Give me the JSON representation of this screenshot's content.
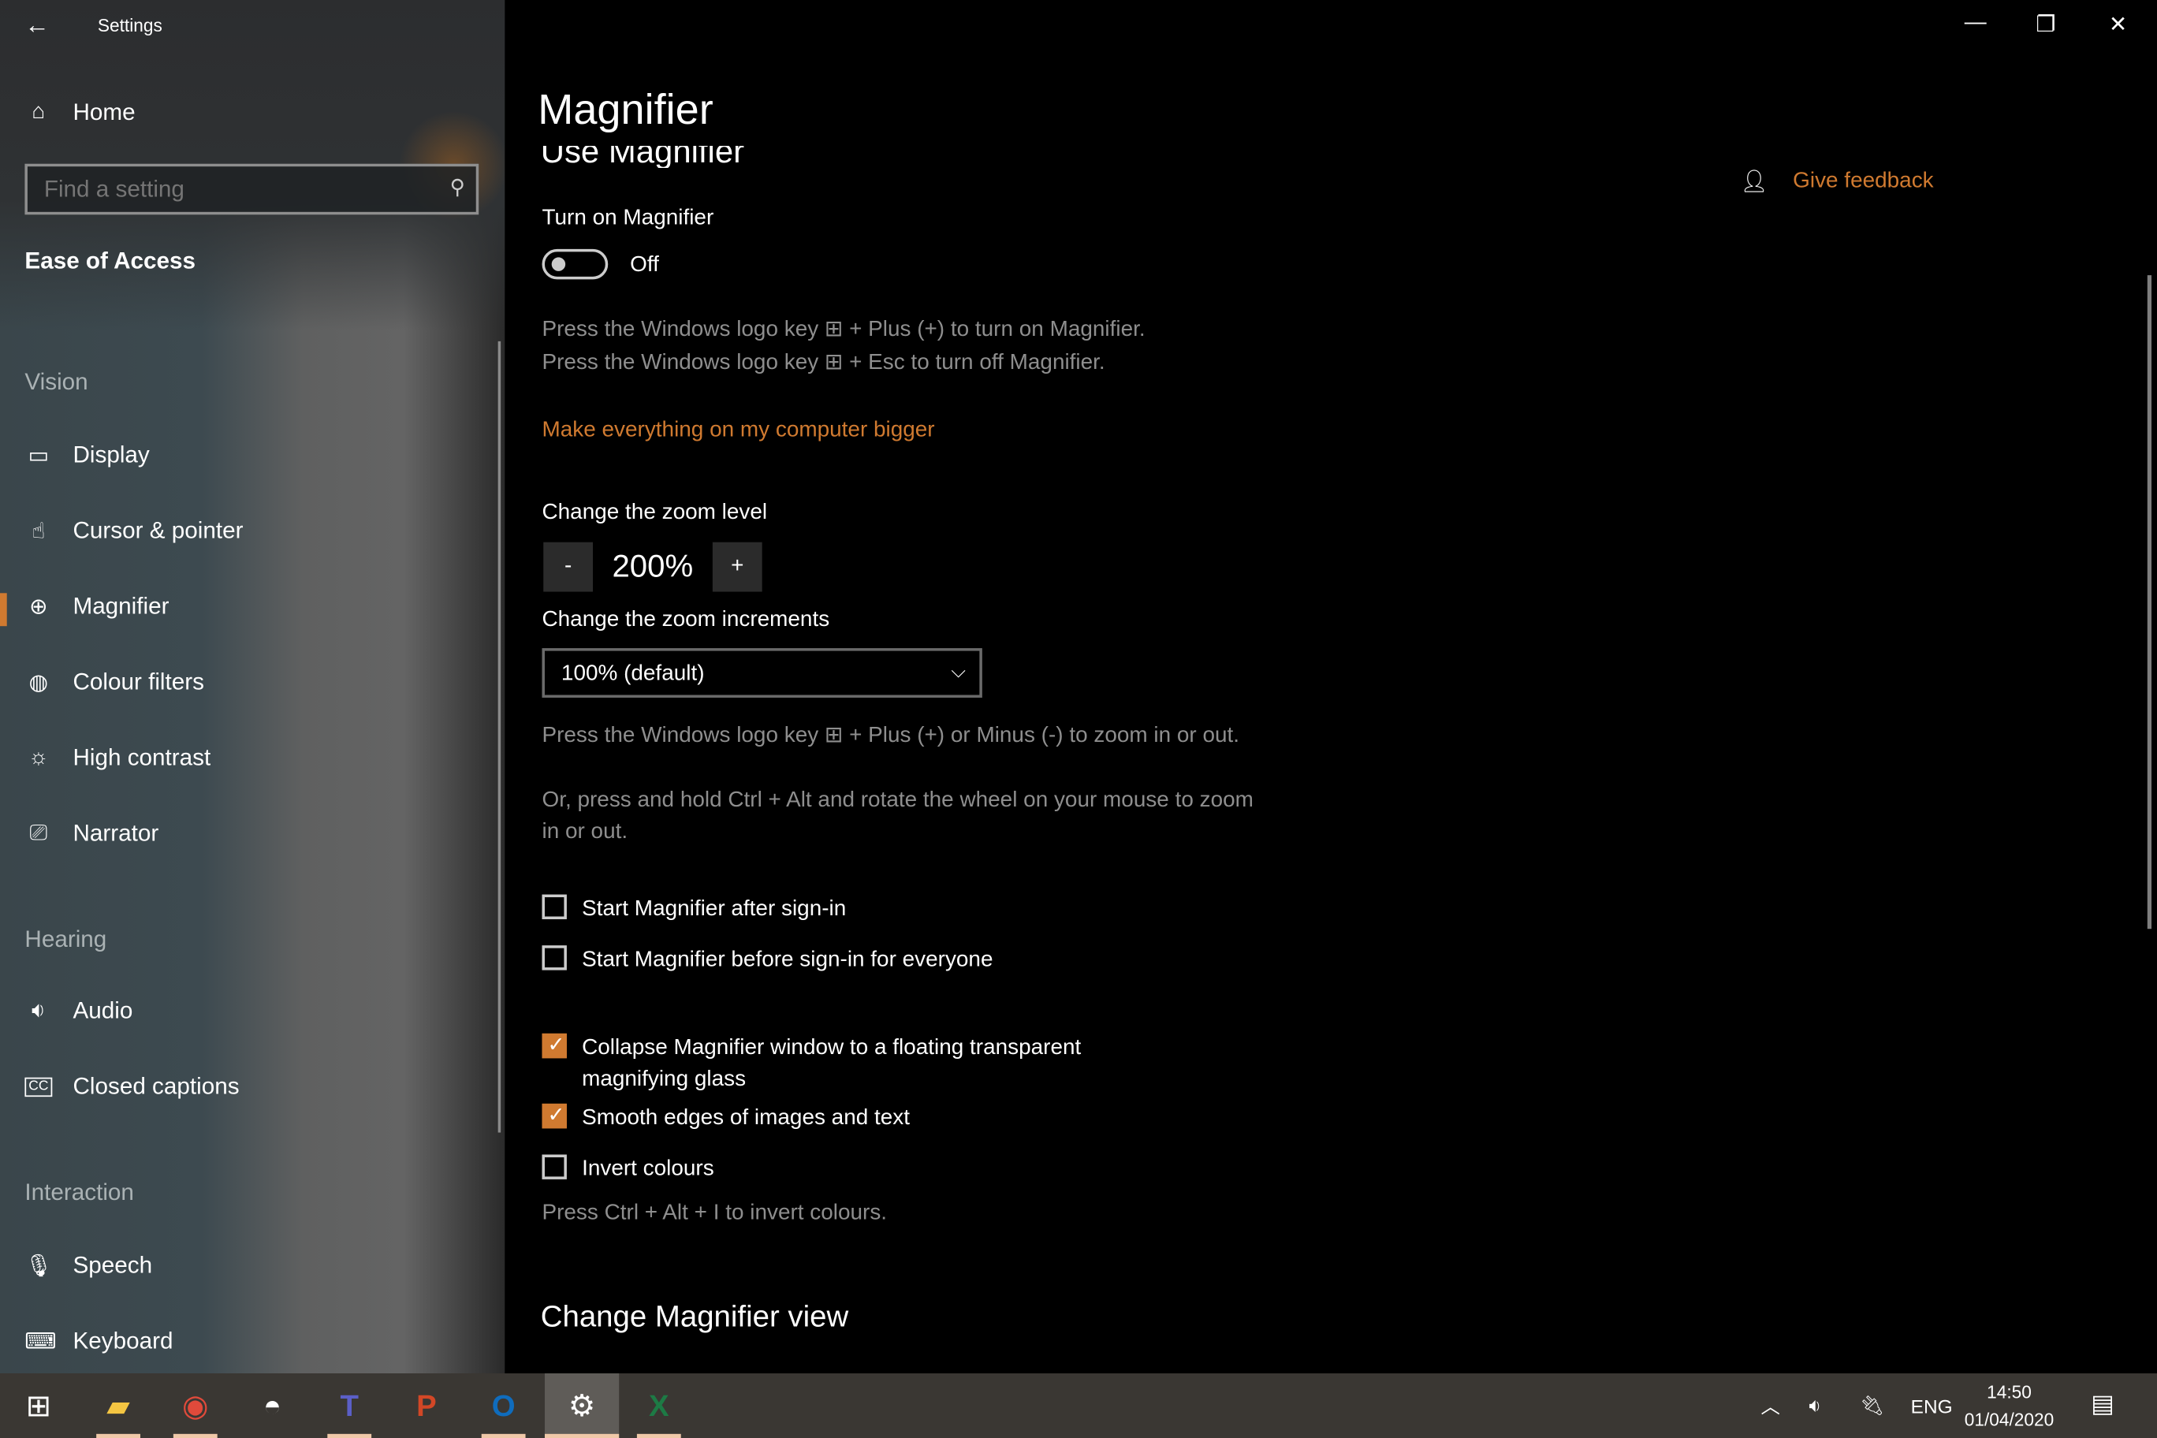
{
  "window": {
    "app_title": "Settings",
    "controls": {
      "minimize": "—",
      "restore": "❐",
      "close": "✕"
    }
  },
  "sidebar": {
    "home": "Home",
    "search_placeholder": "Find a setting",
    "category": "Ease of Access",
    "groups": {
      "vision": "Vision",
      "hearing": "Hearing",
      "interaction": "Interaction"
    },
    "items": [
      {
        "label": "Display",
        "icon": "display-icon"
      },
      {
        "label": "Cursor & pointer",
        "icon": "cursor-pointer-icon"
      },
      {
        "label": "Magnifier",
        "icon": "magnifier-icon",
        "active": true
      },
      {
        "label": "Colour filters",
        "icon": "palette-icon"
      },
      {
        "label": "High contrast",
        "icon": "brightness-icon"
      },
      {
        "label": "Narrator",
        "icon": "narrator-icon"
      },
      {
        "label": "Audio",
        "icon": "speaker-icon"
      },
      {
        "label": "Closed captions",
        "icon": "cc-icon"
      },
      {
        "label": "Speech",
        "icon": "microphone-icon"
      },
      {
        "label": "Keyboard",
        "icon": "keyboard-icon"
      }
    ]
  },
  "main": {
    "page_title": "Magnifier",
    "section_title": "Use Magnifier",
    "turn_on_label": "Turn on Magnifier",
    "toggle_state": "Off",
    "hint_on": "Press the Windows logo key ⊞ + Plus (+) to turn on Magnifier.",
    "hint_off": "Press the Windows logo key ⊞ + Esc to turn off Magnifier.",
    "bigger_link": "Make everything on my computer bigger",
    "zoom_level_label": "Change the zoom level",
    "zoom_minus": "-",
    "zoom_value": "200%",
    "zoom_plus": "+",
    "zoom_increments_label": "Change the zoom increments",
    "zoom_increments_value": "100% (default)",
    "zoom_hint_1": "Press the Windows logo key ⊞ + Plus (+) or Minus (-) to zoom in or out.",
    "zoom_hint_2": "Or, press and hold Ctrl + Alt and rotate the wheel on your mouse to zoom in or out.",
    "checkboxes": [
      {
        "label": "Start Magnifier after sign-in",
        "checked": false
      },
      {
        "label": "Start Magnifier before sign-in for everyone",
        "checked": false
      },
      {
        "label": "Collapse Magnifier window to a floating transparent magnifying glass",
        "checked": true
      },
      {
        "label": "Smooth edges of images and text",
        "checked": true
      },
      {
        "label": "Invert colours",
        "checked": false
      }
    ],
    "invert_hint": "Press Ctrl + Alt + I to invert colours.",
    "view_heading": "Change Magnifier view",
    "feedback": "Give feedback",
    "accent_color": "#d07a30"
  },
  "taskbar": {
    "apps": [
      "Start",
      "File Explorer",
      "Chrome",
      "Photos",
      "Teams",
      "PowerPoint",
      "Outlook",
      "Settings",
      "Excel"
    ],
    "language": "ENG",
    "time": "14:50",
    "date": "01/04/2020"
  }
}
